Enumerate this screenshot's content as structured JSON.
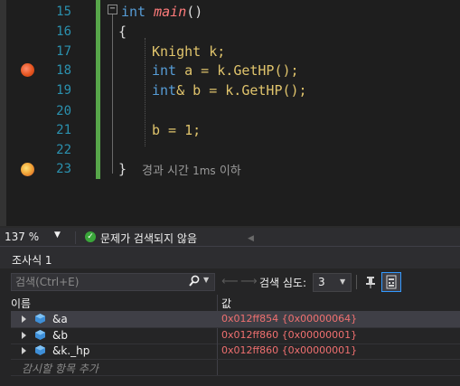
{
  "editor": {
    "line_numbers": [
      "15",
      "16",
      "17",
      "18",
      "19",
      "20",
      "21",
      "22",
      "23"
    ],
    "code": {
      "l15_kw": "int",
      "l15_fn": "main",
      "l15_paren": "()",
      "l16": "{",
      "l17_type": "Knight",
      "l17_rest": " k;",
      "l18_kw": "int",
      "l18_a": " a = k.",
      "l18_fn": "GetHP",
      "l18_end": "();",
      "l19_kw": "int",
      "l19_b": "& b = k.",
      "l19_fn": "GetHP",
      "l19_end": "();",
      "l21_stmt": "b = ",
      "l21_num": "1",
      "l21_end": ";",
      "l23": "}"
    },
    "fold_symbol": "−",
    "perf_tip_prefix": "경과 시간 ",
    "perf_tip_ms": "1ms",
    "perf_tip_suffix": " 이하",
    "breakpoint_lines": [
      "18",
      "23"
    ]
  },
  "statusbar": {
    "zoom": "137 %",
    "status": "문제가 검색되지 않음"
  },
  "watch": {
    "title": "조사식 1",
    "search_placeholder": "검색(Ctrl+E)",
    "depth_label": "검색 심도:",
    "depth_value": "3",
    "header_name": "이름",
    "header_value": "값",
    "rows": [
      {
        "name": "&a",
        "value": "0x012ff854 {0x00000064}"
      },
      {
        "name": "&b",
        "value": "0x012ff860 {0x00000001}"
      },
      {
        "name": "&k._hp",
        "value": "0x012ff860 {0x00000001}"
      }
    ],
    "add_item": "감시할 항목 추가"
  },
  "colors": {
    "background": "#1e1e1e",
    "line_number": "#2b91af",
    "keyword": "#569cd6",
    "type": "#4ec9b0",
    "function": "#dcdcaa",
    "value_changed": "#f07070",
    "changed_margin": "#57a64a"
  }
}
